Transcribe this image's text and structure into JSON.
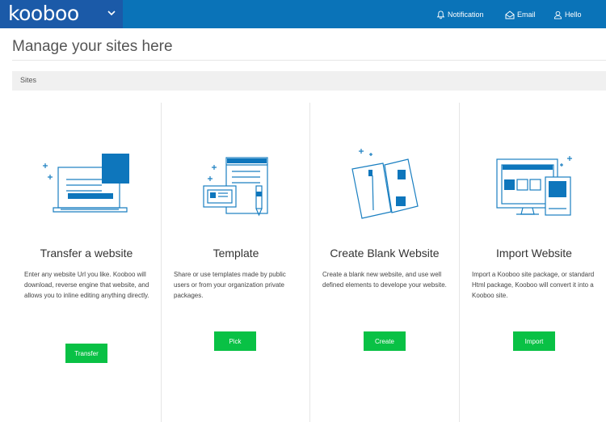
{
  "header": {
    "logo": "kooboo",
    "nav": [
      {
        "label": "Notification",
        "icon": "bell-icon"
      },
      {
        "label": "Email",
        "icon": "envelope-icon"
      },
      {
        "label": "Hello",
        "icon": "user-icon"
      }
    ]
  },
  "page": {
    "title": "Manage your sites here",
    "breadcrumb": "Sites"
  },
  "cards": [
    {
      "title": "Transfer a website",
      "description": "Enter any website Url you like. Kooboo will download, reverse engine that website, and allows you to inline editing anything directly.",
      "button": "Transfer",
      "icon": "laptop-icon"
    },
    {
      "title": "Template",
      "description": "Share or use templates made by public users or from your organization private packages.",
      "button": "Pick",
      "icon": "template-icon"
    },
    {
      "title": "Create Blank Website",
      "description": "Create a blank new website, and use well defined elements to develope your website.",
      "button": "Create",
      "icon": "blank-pages-icon"
    },
    {
      "title": "Import Website",
      "description": "Import a Kooboo site package, or standard Html package, Kooboo will convert it into a Kooboo site.",
      "button": "Import",
      "icon": "devices-icon"
    }
  ],
  "colors": {
    "header": "#0a73b8",
    "brand": "#1b5aa8",
    "button": "#09c145",
    "illustration": "#1a7fc1"
  }
}
